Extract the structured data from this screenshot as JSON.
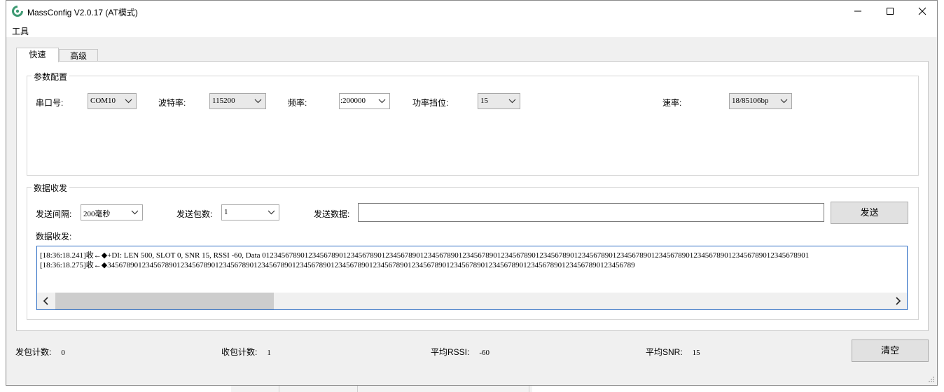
{
  "window": {
    "title": "MassConfig V2.0.17 (AT模式)",
    "icon": "app-logo-icon"
  },
  "menu": {
    "tools": "工具"
  },
  "tabs": [
    {
      "label": "快速",
      "active": true
    },
    {
      "label": "高级",
      "active": false
    }
  ],
  "params": {
    "group_title": "参数配置",
    "port": {
      "label": "串口号:",
      "value": "COM10"
    },
    "baud": {
      "label": "波特率:",
      "value": "115200"
    },
    "freq": {
      "label": "频率:",
      "value": ":200000"
    },
    "power": {
      "label": "功率挡位:",
      "value": "15"
    },
    "rate": {
      "label": "速率:",
      "value": "18/85106bp"
    }
  },
  "data": {
    "group_title": "数据收发",
    "interval": {
      "label": "发送间隔:",
      "value": "200毫秒"
    },
    "count": {
      "label": "发送包数:",
      "value": "1"
    },
    "send_data": {
      "label": "发送数据:",
      "value": ""
    },
    "send_button": "发送",
    "log_label": "数据收发:",
    "log_lines": [
      "[18:36:18.241]收←◆+DI: LEN 500, SLOT 0, SNR 15, RSSI -60, Data 0123456789012345678901234567890123456789012345678901234567890123456789012345678901234567890123456789012345678901234567890123456789012345678901",
      "[18:36:18.275]收←◆34567890123456789012345678901234567890123456789012345678901234567890123456789012345678901234567890123456789012345678901234567890123456789"
    ]
  },
  "status": {
    "sent": {
      "label": "发包计数:",
      "value": "0"
    },
    "recv": {
      "label": "收包计数:",
      "value": "1"
    },
    "rssi": {
      "label": "平均RSSI:",
      "value": "-60"
    },
    "snr": {
      "label": "平均SNR:",
      "value": "15"
    },
    "clear_button": "清空"
  },
  "colors": {
    "accent_border": "#2b6cc4",
    "logo_green": "#3e9a73"
  }
}
